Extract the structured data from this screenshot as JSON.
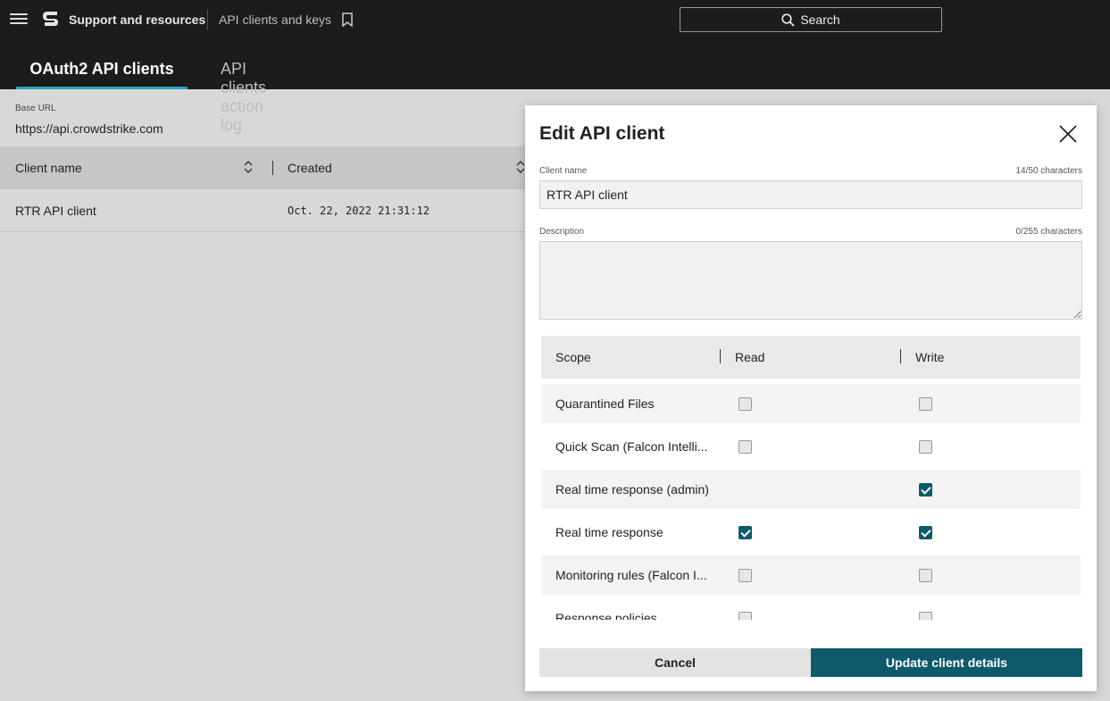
{
  "header": {
    "app_title": "Support and resources",
    "breadcrumb": "API clients and keys",
    "search_label": "Search"
  },
  "tabs": [
    {
      "label": "OAuth2 API clients",
      "active": true
    },
    {
      "label": "API clients action log",
      "active": false
    }
  ],
  "page": {
    "base_url_label": "Base URL",
    "base_url": "https://api.crowdstrike.com",
    "columns": [
      "Client name",
      "Created"
    ],
    "rows": [
      {
        "client_name": "RTR API client",
        "created": "Oct. 22, 2022 21:31:12"
      }
    ]
  },
  "modal": {
    "title": "Edit API client",
    "client_name_label": "Client name",
    "client_name_count": "14/50 characters",
    "client_name_value": "RTR API client",
    "description_label": "Description",
    "description_count": "0/255 characters",
    "description_value": "",
    "scope_columns": [
      "Scope",
      "Read",
      "Write"
    ],
    "scopes": [
      {
        "name": "Quarantined Files",
        "read": false,
        "write": false,
        "has_read": true
      },
      {
        "name": "Quick Scan (Falcon Intelli...",
        "read": false,
        "write": false,
        "has_read": true
      },
      {
        "name": "Real time response (admin)",
        "read": false,
        "write": true,
        "has_read": false
      },
      {
        "name": "Real time response",
        "read": true,
        "write": true,
        "has_read": true
      },
      {
        "name": "Monitoring rules (Falcon I...",
        "read": false,
        "write": false,
        "has_read": true
      },
      {
        "name": "Response policies",
        "read": false,
        "write": false,
        "has_read": true
      }
    ],
    "cancel_label": "Cancel",
    "update_label": "Update client details"
  },
  "colors": {
    "topbar": "#1c1c1c",
    "accent": "#0d5a6b",
    "tab_underline": "#2aa3c0"
  }
}
